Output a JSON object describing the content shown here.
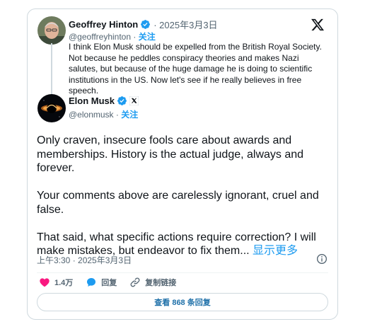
{
  "quoted_post": {
    "author_name": "Geoffrey Hinton",
    "date": "· 2025年3月3日",
    "handle": "@geoffreyhinton",
    "separator": " · ",
    "follow_label": "关注",
    "text": "I think Elon Musk should be expelled from the British Royal Society. Not because he peddles conspiracy theories and makes Nazi salutes, but because of the huge damage he is doing to scientific institutions in the US. Now let's see if he really believes in free speech."
  },
  "post": {
    "author_name": "Elon Musk",
    "handle": "@elonmusk",
    "separator": " · ",
    "follow_label": "关注",
    "paragraphs": [
      "Only craven, insecure fools care about awards and memberships. History is the actual judge, always and forever.",
      "Your comments above are carelessly ignorant, cruel and false.",
      "That said, what specific actions require correction? I will make mistakes, but endeavor to fix them..."
    ],
    "show_more_label": "显示更多",
    "timestamp": "上午3:30 · 2025年3月3日"
  },
  "actions": {
    "like_count": "1.4万",
    "reply_label": "回复",
    "copy_link_label": "复制链接"
  },
  "replies_button_label": "查看 868 条回复",
  "colors": {
    "accent": "#1d9bf0",
    "like": "#f91880",
    "muted": "#536471",
    "border": "#cfd9de"
  },
  "icons": [
    "x-logo-icon",
    "verified-icon",
    "x-affiliate-icon",
    "info-icon",
    "heart-icon",
    "reply-bubble-icon",
    "link-icon"
  ]
}
